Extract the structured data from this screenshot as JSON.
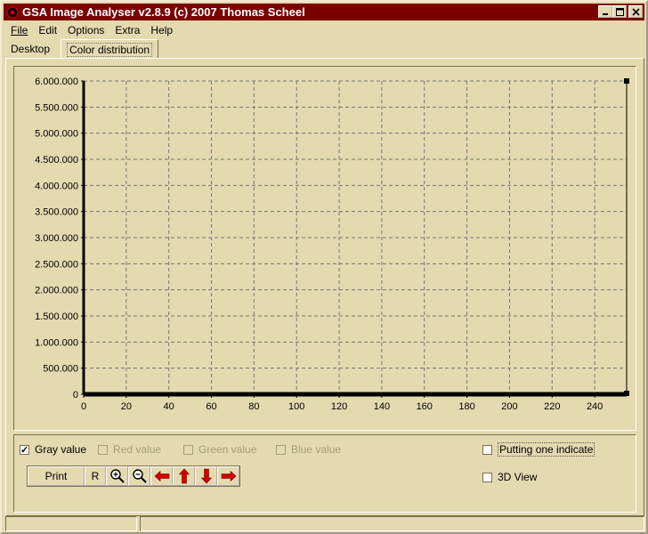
{
  "window": {
    "title": "GSA Image Analyser v2.8.9 (c) 2007   Thomas Scheel",
    "accent_color": "#7a0000",
    "buttons": [
      "minimize-icon",
      "maximize-icon",
      "close-icon"
    ]
  },
  "menu": {
    "items": [
      {
        "label": "File",
        "mnemonic": "F"
      },
      {
        "label": "Edit",
        "mnemonic": "d"
      },
      {
        "label": "Options",
        "mnemonic": "O"
      },
      {
        "label": "Extra",
        "mnemonic": "E"
      },
      {
        "label": "Help",
        "mnemonic": "H"
      }
    ]
  },
  "tabs": [
    {
      "label": "Desktop",
      "active": false
    },
    {
      "label": "Color distribution",
      "active": true
    }
  ],
  "chart_data": {
    "type": "bar",
    "title": "",
    "xlabel": "",
    "ylabel": "",
    "xlim": [
      0,
      255
    ],
    "ylim": [
      0,
      6000000
    ],
    "x_ticks": [
      "0",
      "20",
      "40",
      "60",
      "80",
      "100",
      "120",
      "140",
      "160",
      "180",
      "200",
      "220",
      "240"
    ],
    "y_ticks": [
      "0",
      "500.000",
      "1.000.000",
      "1.500.000",
      "2.000.000",
      "2.500.000",
      "3.000.000",
      "3.500.000",
      "4.000.000",
      "4.500.000",
      "5.000.000",
      "5.500.000",
      "6.000.000"
    ],
    "grid": true,
    "series": [
      {
        "name": "Gray value",
        "color": "#000000",
        "points": [
          {
            "x": 255,
            "y": 6000000
          }
        ]
      }
    ]
  },
  "options": {
    "channels": [
      {
        "label": "Gray value",
        "checked": true,
        "enabled": true
      },
      {
        "label": "Red value",
        "checked": false,
        "enabled": false
      },
      {
        "label": "Green value",
        "checked": false,
        "enabled": false
      },
      {
        "label": "Blue value",
        "checked": false,
        "enabled": false
      }
    ],
    "putting": {
      "label": "Putting one indicate",
      "checked": false
    },
    "view3d": {
      "label": "3D View",
      "checked": false
    }
  },
  "toolbar": {
    "print_label": "Print",
    "reset_label": "R",
    "icons": [
      "zoom-in-icon",
      "zoom-out-icon",
      "arrow-left-icon",
      "arrow-up-icon",
      "arrow-down-icon",
      "arrow-right-icon"
    ]
  }
}
